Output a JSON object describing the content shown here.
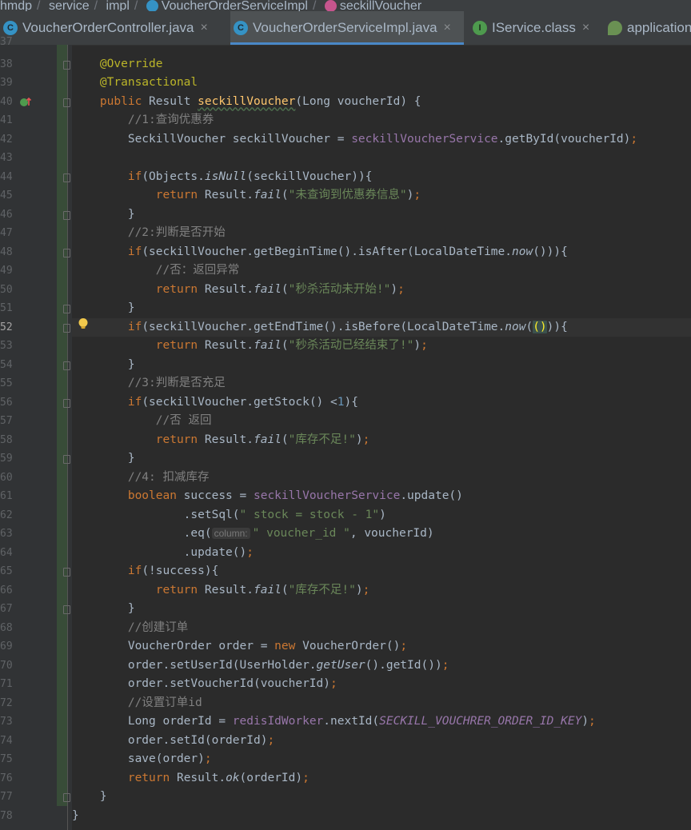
{
  "breadcrumb": {
    "items": [
      "hmdp",
      "service",
      "impl",
      "VoucherOrderServiceImpl",
      "seckillVoucher"
    ],
    "separator": "/"
  },
  "tabs": [
    {
      "label": "VoucherOrderController.java",
      "icon": "class-icon",
      "active": false
    },
    {
      "label": "VoucherOrderServiceImpl.java",
      "icon": "class-icon",
      "active": true
    },
    {
      "label": "IService.class",
      "icon": "interface-icon",
      "active": false
    },
    {
      "label": "application",
      "icon": "spring-config-icon",
      "active": false
    }
  ],
  "tab_close_glyph": "×",
  "editor": {
    "first_partial_line": "37",
    "current_line": "52",
    "lines": [
      {
        "n": "38",
        "fold": true,
        "tokens": [
          [
            "    ",
            ""
          ],
          [
            "@Override",
            "annotation"
          ]
        ]
      },
      {
        "n": "39",
        "fold": false,
        "tokens": [
          [
            "    ",
            ""
          ],
          [
            "@Transactional",
            "annotation"
          ]
        ]
      },
      {
        "n": "40",
        "fold": true,
        "impl": true,
        "tokens": [
          [
            "    ",
            ""
          ],
          [
            "public",
            "keyword"
          ],
          [
            " Result ",
            ""
          ],
          [
            "seckillVoucher",
            "method-decl underline"
          ],
          [
            "(Long voucherId) {",
            ""
          ]
        ]
      },
      {
        "n": "41",
        "fold": false,
        "tokens": [
          [
            "        ",
            ""
          ],
          [
            "//1:查询优惠券",
            "comment"
          ]
        ]
      },
      {
        "n": "42",
        "fold": false,
        "tokens": [
          [
            "        SeckillVoucher seckillVoucher = ",
            ""
          ],
          [
            "seckillVoucherService",
            "field"
          ],
          [
            ".getById(voucherId)",
            ""
          ],
          [
            ";",
            "keyword"
          ]
        ]
      },
      {
        "n": "43",
        "fold": false,
        "tokens": []
      },
      {
        "n": "44",
        "fold": true,
        "tokens": [
          [
            "        ",
            ""
          ],
          [
            "if",
            "keyword"
          ],
          [
            "(Objects.",
            ""
          ],
          [
            "isNull",
            "italic"
          ],
          [
            "(seckillVoucher)){",
            ""
          ]
        ]
      },
      {
        "n": "45",
        "fold": false,
        "tokens": [
          [
            "            ",
            ""
          ],
          [
            "return",
            "keyword"
          ],
          [
            " Result.",
            ""
          ],
          [
            "fail",
            "italic"
          ],
          [
            "(",
            ""
          ],
          [
            "\"未查询到优惠券信息\"",
            "string"
          ],
          [
            ")",
            ""
          ],
          [
            ";",
            "keyword"
          ]
        ]
      },
      {
        "n": "46",
        "fold": true,
        "tokens": [
          [
            "        }",
            ""
          ]
        ]
      },
      {
        "n": "47",
        "fold": false,
        "tokens": [
          [
            "        ",
            ""
          ],
          [
            "//2:判断是否开始",
            "comment"
          ]
        ]
      },
      {
        "n": "48",
        "fold": true,
        "tokens": [
          [
            "        ",
            ""
          ],
          [
            "if",
            "keyword"
          ],
          [
            "(seckillVoucher.getBeginTime().isAfter(LocalDateTime.",
            ""
          ],
          [
            "now",
            "italic"
          ],
          [
            "())){",
            ""
          ]
        ]
      },
      {
        "n": "49",
        "fold": false,
        "tokens": [
          [
            "            ",
            ""
          ],
          [
            "//否：返回异常",
            "comment"
          ]
        ]
      },
      {
        "n": "50",
        "fold": false,
        "tokens": [
          [
            "            ",
            ""
          ],
          [
            "return",
            "keyword"
          ],
          [
            " Result.",
            ""
          ],
          [
            "fail",
            "italic"
          ],
          [
            "(",
            ""
          ],
          [
            "\"秒杀活动未开始!\"",
            "string"
          ],
          [
            ")",
            ""
          ],
          [
            ";",
            "keyword"
          ]
        ]
      },
      {
        "n": "51",
        "fold": true,
        "tokens": [
          [
            "        }",
            ""
          ]
        ]
      },
      {
        "n": "52",
        "fold": true,
        "bulb": true,
        "tokens": [
          [
            "        ",
            ""
          ],
          [
            "if",
            "keyword"
          ],
          [
            "(seckillVoucher.getEndTime().isBefore(LocalDateTime.",
            ""
          ],
          [
            "now",
            "italic"
          ],
          [
            "(",
            ""
          ],
          [
            "()",
            "paren-match"
          ],
          [
            ")){",
            ""
          ]
        ]
      },
      {
        "n": "53",
        "fold": false,
        "tokens": [
          [
            "            ",
            ""
          ],
          [
            "return",
            "keyword"
          ],
          [
            " Result.",
            ""
          ],
          [
            "fail",
            "italic"
          ],
          [
            "(",
            ""
          ],
          [
            "\"秒杀活动已经结束了!\"",
            "string"
          ],
          [
            ")",
            ""
          ],
          [
            ";",
            "keyword"
          ]
        ]
      },
      {
        "n": "54",
        "fold": true,
        "tokens": [
          [
            "        }",
            ""
          ]
        ]
      },
      {
        "n": "55",
        "fold": false,
        "tokens": [
          [
            "        ",
            ""
          ],
          [
            "//3:判断是否充足",
            "comment"
          ]
        ]
      },
      {
        "n": "56",
        "fold": true,
        "tokens": [
          [
            "        ",
            ""
          ],
          [
            "if",
            "keyword"
          ],
          [
            "(seckillVoucher.getStock() <",
            ""
          ],
          [
            "1",
            "number"
          ],
          [
            "){",
            ""
          ]
        ]
      },
      {
        "n": "57",
        "fold": false,
        "tokens": [
          [
            "            ",
            ""
          ],
          [
            "//否 返回",
            "comment"
          ]
        ]
      },
      {
        "n": "58",
        "fold": false,
        "tokens": [
          [
            "            ",
            ""
          ],
          [
            "return",
            "keyword"
          ],
          [
            " Result.",
            ""
          ],
          [
            "fail",
            "italic"
          ],
          [
            "(",
            ""
          ],
          [
            "\"库存不足!\"",
            "string"
          ],
          [
            ")",
            ""
          ],
          [
            ";",
            "keyword"
          ]
        ]
      },
      {
        "n": "59",
        "fold": true,
        "tokens": [
          [
            "        }",
            ""
          ]
        ]
      },
      {
        "n": "60",
        "fold": false,
        "tokens": [
          [
            "        ",
            ""
          ],
          [
            "//4: 扣减库存",
            "comment"
          ]
        ]
      },
      {
        "n": "61",
        "fold": false,
        "tokens": [
          [
            "        ",
            ""
          ],
          [
            "boolean",
            "keyword"
          ],
          [
            " success = ",
            ""
          ],
          [
            "seckillVoucherService",
            "field"
          ],
          [
            ".update()",
            ""
          ]
        ]
      },
      {
        "n": "62",
        "fold": false,
        "tokens": [
          [
            "                .setSql(",
            ""
          ],
          [
            "\" stock = stock - 1\"",
            "string"
          ],
          [
            ")",
            ""
          ]
        ]
      },
      {
        "n": "63",
        "fold": false,
        "tokens": [
          [
            "                .eq(",
            ""
          ],
          [
            "column:",
            "hint"
          ],
          [
            "\" voucher_id \"",
            "string"
          ],
          [
            ", voucherId)",
            ""
          ]
        ]
      },
      {
        "n": "64",
        "fold": false,
        "tokens": [
          [
            "                .update()",
            ""
          ],
          [
            ";",
            "keyword"
          ]
        ]
      },
      {
        "n": "65",
        "fold": true,
        "tokens": [
          [
            "        ",
            ""
          ],
          [
            "if",
            "keyword"
          ],
          [
            "(!success){",
            ""
          ]
        ]
      },
      {
        "n": "66",
        "fold": false,
        "tokens": [
          [
            "            ",
            ""
          ],
          [
            "return",
            "keyword"
          ],
          [
            " Result.",
            ""
          ],
          [
            "fail",
            "italic"
          ],
          [
            "(",
            ""
          ],
          [
            "\"库存不足!\"",
            "string"
          ],
          [
            ")",
            ""
          ],
          [
            ";",
            "keyword"
          ]
        ]
      },
      {
        "n": "67",
        "fold": true,
        "tokens": [
          [
            "        }",
            ""
          ]
        ]
      },
      {
        "n": "68",
        "fold": false,
        "tokens": [
          [
            "        ",
            ""
          ],
          [
            "//创建订单",
            "comment"
          ]
        ]
      },
      {
        "n": "69",
        "fold": false,
        "tokens": [
          [
            "        VoucherOrder order = ",
            ""
          ],
          [
            "new",
            "keyword"
          ],
          [
            " VoucherOrder()",
            ""
          ],
          [
            ";",
            "keyword"
          ]
        ]
      },
      {
        "n": "70",
        "fold": false,
        "tokens": [
          [
            "        order.setUserId(UserHolder.",
            ""
          ],
          [
            "getUser",
            "italic"
          ],
          [
            "().getId())",
            ""
          ],
          [
            ";",
            "keyword"
          ]
        ]
      },
      {
        "n": "71",
        "fold": false,
        "tokens": [
          [
            "        order.setVoucherId(voucherId)",
            ""
          ],
          [
            ";",
            "keyword"
          ]
        ]
      },
      {
        "n": "72",
        "fold": false,
        "tokens": [
          [
            "        ",
            ""
          ],
          [
            "//设置订单id",
            "comment"
          ]
        ]
      },
      {
        "n": "73",
        "fold": false,
        "tokens": [
          [
            "        Long orderId = ",
            ""
          ],
          [
            "redisIdWorker",
            "field"
          ],
          [
            ".nextId(",
            ""
          ],
          [
            "SECKILL_VOUCHRER_ORDER_ID_KEY",
            "constant"
          ],
          [
            ")",
            ""
          ],
          [
            ";",
            "keyword"
          ]
        ]
      },
      {
        "n": "74",
        "fold": false,
        "tokens": [
          [
            "        order.setId(orderId)",
            ""
          ],
          [
            ";",
            "keyword"
          ]
        ]
      },
      {
        "n": "75",
        "fold": false,
        "tokens": [
          [
            "        save(order)",
            ""
          ],
          [
            ";",
            "keyword"
          ]
        ]
      },
      {
        "n": "76",
        "fold": false,
        "tokens": [
          [
            "        ",
            ""
          ],
          [
            "return",
            "keyword"
          ],
          [
            " Result.",
            ""
          ],
          [
            "ok",
            "italic"
          ],
          [
            "(orderId)",
            ""
          ],
          [
            ";",
            "keyword"
          ]
        ]
      },
      {
        "n": "77",
        "fold": true,
        "tokens": [
          [
            "    }",
            ""
          ]
        ]
      },
      {
        "n": "78",
        "fold": false,
        "tokens": [
          [
            "}",
            ""
          ]
        ]
      }
    ]
  }
}
